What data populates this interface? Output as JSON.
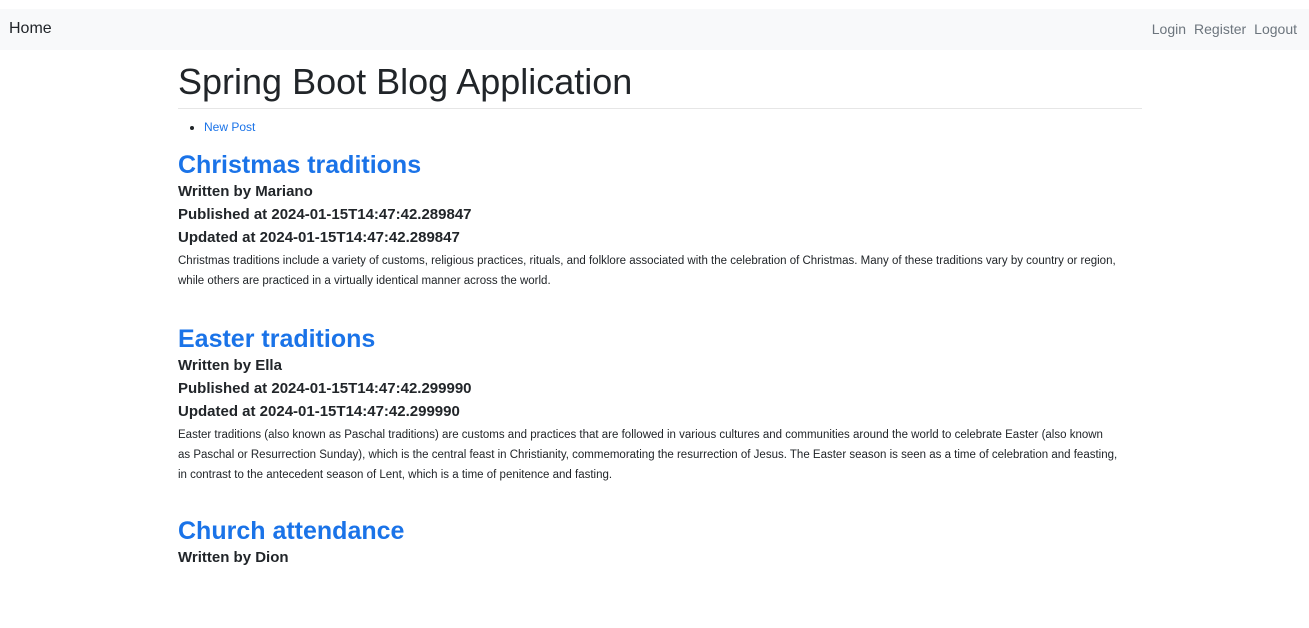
{
  "nav": {
    "brand": "Home",
    "links": [
      "Login",
      "Register",
      "Logout"
    ]
  },
  "page": {
    "title": "Spring Boot Blog Application",
    "actions": [
      "New Post"
    ]
  },
  "posts": [
    {
      "title": "Christmas traditions",
      "author": "Written by Mariano",
      "published": "Published at 2024-01-15T14:47:42.289847",
      "updated": "Updated at 2024-01-15T14:47:42.289847",
      "body": "Christmas traditions include a variety of customs, religious practices, rituals, and folklore associated with the celebration of Christmas. Many of these traditions vary by country or region, while others are practiced in a virtually identical manner across the world."
    },
    {
      "title": "Easter traditions",
      "author": "Written by Ella",
      "published": "Published at 2024-01-15T14:47:42.299990",
      "updated": "Updated at 2024-01-15T14:47:42.299990",
      "body": "Easter traditions (also known as Paschal traditions) are customs and practices that are followed in various cultures and communities around the world to celebrate Easter (also known as Paschal or Resurrection Sunday), which is the central feast in Christianity, commemorating the resurrection of Jesus. The Easter season is seen as a time of celebration and feasting, in contrast to the antecedent season of Lent, which is a time of penitence and fasting."
    },
    {
      "title": "Church attendance",
      "author": "Written by Dion"
    }
  ]
}
